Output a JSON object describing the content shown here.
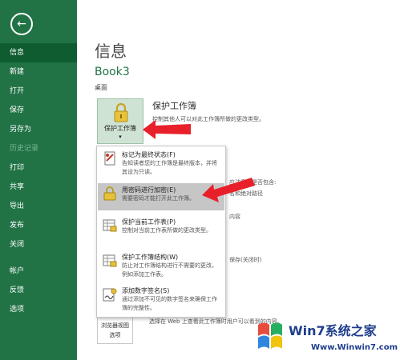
{
  "sidebar": {
    "back_icon": "back-arrow-icon",
    "items": [
      {
        "label": "信息",
        "active": true,
        "disabled": false
      },
      {
        "label": "新建",
        "active": false,
        "disabled": false
      },
      {
        "label": "打开",
        "active": false,
        "disabled": false
      },
      {
        "label": "保存",
        "active": false,
        "disabled": false
      },
      {
        "label": "另存为",
        "active": false,
        "disabled": false
      },
      {
        "label": "历史记录",
        "active": false,
        "disabled": true
      },
      {
        "label": "打印",
        "active": false,
        "disabled": false
      },
      {
        "label": "共享",
        "active": false,
        "disabled": false
      },
      {
        "label": "导出",
        "active": false,
        "disabled": false
      },
      {
        "label": "发布",
        "active": false,
        "disabled": false
      },
      {
        "label": "关闭",
        "active": false,
        "disabled": false
      },
      {
        "label": "帐户",
        "active": false,
        "disabled": false
      },
      {
        "label": "反馈",
        "active": false,
        "disabled": false
      },
      {
        "label": "选项",
        "active": false,
        "disabled": false
      }
    ]
  },
  "main": {
    "title": "信息",
    "workbook_name": "Book3",
    "location": "桌面",
    "protect": {
      "button_label": "保护工作簿",
      "caret": "▾",
      "section_title": "保护工作簿",
      "section_desc": "控制其他人可以对此工作簿所做的更改类型。"
    },
    "background_fragments": {
      "inspect": "应注意其是否包含:",
      "inspect_line1": "名和绝对路径",
      "inspect_line2": "内容",
      "versions": "保存(关闭时)",
      "browser": "选择在 Web 上查看此工作簿时用户可以看到的内容。"
    },
    "browser_view": {
      "label_line1": "浏览器视图",
      "label_line2": "选项"
    }
  },
  "menu": {
    "items": [
      {
        "title": "标记为最终状态(F)",
        "desc": "告知读者您的工作簿是最终版本，并将其设为只读。",
        "icon": "mark-final-icon",
        "highlighted": false
      },
      {
        "title": "用密码进行加密(E)",
        "desc": "需要密码才能打开此工作簿。",
        "icon": "encrypt-lock-icon",
        "highlighted": true
      },
      {
        "title": "保护当前工作表(P)",
        "desc": "控制对当前工作表所做的更改类型。",
        "icon": "protect-sheet-icon",
        "highlighted": false
      },
      {
        "title": "保护工作簿结构(W)",
        "desc": "防止对工作簿结构进行不需要的更改，例如添加工作表。",
        "icon": "protect-structure-icon",
        "highlighted": false
      },
      {
        "title": "添加数字签名(S)",
        "desc": "通过添加不可见的数字签名来确保工作簿的完整性。",
        "icon": "digital-signature-icon",
        "highlighted": false
      }
    ]
  },
  "watermark": {
    "brand": "Win7系统之家",
    "url": "Www.Winwin7.com"
  },
  "colors": {
    "sidebar_bg": "#217346",
    "sidebar_active": "#0e5c2f",
    "accent_green": "#217346",
    "arrow_red": "#e8202a",
    "menu_highlight": "#c6c6c6"
  }
}
